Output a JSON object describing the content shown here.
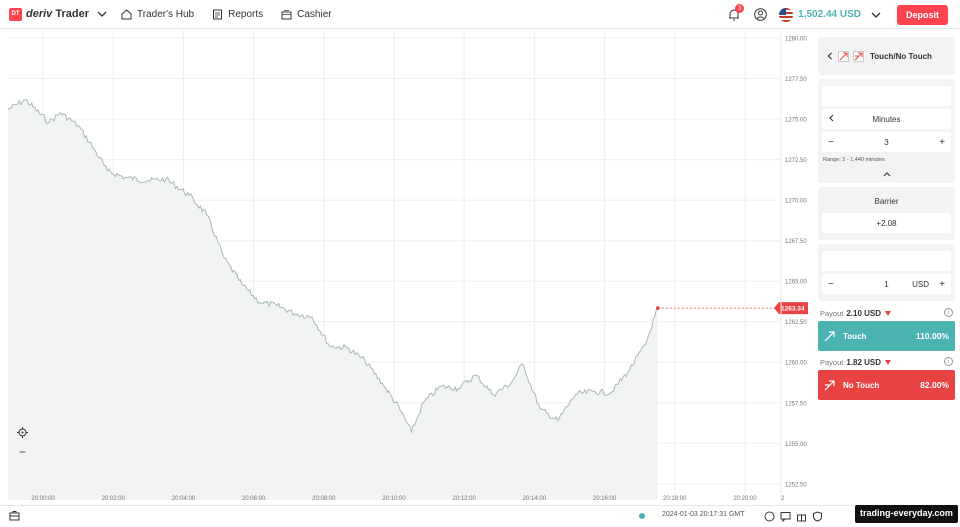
{
  "header": {
    "logo_badge": "DT",
    "logo_brand": "deriv",
    "logo_product": "Trader",
    "nav": [
      {
        "label": "Trader's Hub",
        "icon": "home-icon"
      },
      {
        "label": "Reports",
        "icon": "reports-icon"
      },
      {
        "label": "Cashier",
        "icon": "cashier-icon"
      }
    ],
    "notification_count": "3",
    "balance": "1,502.44 USD",
    "deposit_label": "Deposit"
  },
  "chart": {
    "y_ticks": [
      "1280.00",
      "1277.50",
      "1275.00",
      "1272.50",
      "1270.00",
      "1267.50",
      "1265.00",
      "1262.50",
      "1260.00",
      "1257.50",
      "1255.00",
      "1252.50"
    ],
    "x_ticks": [
      "20:00:00",
      "20:02:00",
      "20:04:00",
      "20:06:00",
      "20:08:00",
      "20:10:00",
      "20:12:00",
      "20:14:00",
      "20:16:00",
      "20:18:00",
      "20:20:00"
    ],
    "current_price": "1263.34",
    "line_color": "#a9b8bc",
    "fill_color": "#f2f4f4",
    "marker_color": "#e84242",
    "zoom_out_label": "−",
    "axis_extra_bottom": "2"
  },
  "chart_data": {
    "type": "line",
    "x_unit": "time",
    "y_range": [
      1251.5,
      1280.5
    ],
    "x_range": [
      "19:59:00",
      "20:21:00"
    ],
    "points": [
      [
        "19:59:00",
        1275.6
      ],
      [
        "19:59:30",
        1276.2
      ],
      [
        "20:00:10",
        1274.8
      ],
      [
        "20:00:30",
        1275.4
      ],
      [
        "20:01:00",
        1274.6
      ],
      [
        "20:01:30",
        1273.0
      ],
      [
        "20:01:50",
        1271.8
      ],
      [
        "20:02:20",
        1271.4
      ],
      [
        "20:03:00",
        1271.2
      ],
      [
        "20:03:30",
        1271.3
      ],
      [
        "20:04:10",
        1270.3
      ],
      [
        "20:04:40",
        1269.1
      ],
      [
        "20:05:10",
        1266.4
      ],
      [
        "20:05:40",
        1264.8
      ],
      [
        "20:06:10",
        1263.7
      ],
      [
        "20:06:40",
        1263.5
      ],
      [
        "20:07:10",
        1263.0
      ],
      [
        "20:07:40",
        1262.8
      ],
      [
        "20:08:10",
        1261.0
      ],
      [
        "20:08:40",
        1260.9
      ],
      [
        "20:09:10",
        1260.1
      ],
      [
        "20:09:40",
        1258.7
      ],
      [
        "20:10:10",
        1257.1
      ],
      [
        "20:10:30",
        1255.7
      ],
      [
        "20:10:50",
        1257.5
      ],
      [
        "20:11:20",
        1258.5
      ],
      [
        "20:11:50",
        1258.4
      ],
      [
        "20:12:20",
        1259.2
      ],
      [
        "20:12:50",
        1258.0
      ],
      [
        "20:13:20",
        1258.7
      ],
      [
        "20:13:40",
        1259.9
      ],
      [
        "20:14:10",
        1257.1
      ],
      [
        "20:14:40",
        1256.4
      ],
      [
        "20:15:10",
        1258.0
      ],
      [
        "20:15:40",
        1258.2
      ],
      [
        "20:16:10",
        1258.1
      ],
      [
        "20:16:40",
        1259.4
      ],
      [
        "20:17:10",
        1261.1
      ],
      [
        "20:17:31",
        1263.34
      ]
    ]
  },
  "sidebar": {
    "trade_type": "Touch/No Touch",
    "duration_unit": "Minutes",
    "duration_value": "3",
    "range_text": "Range: 2 - 1,440 minutes",
    "barrier_label": "Barrier",
    "barrier_value": "+2.08",
    "stake_value": "1",
    "stake_currency": "USD",
    "payout_label": "Payout",
    "touch_payout": "2.10 USD",
    "touch_label": "Touch",
    "touch_pct": "110.00%",
    "notouch_payout": "1.82 USD",
    "notouch_label": "No Touch",
    "notouch_pct": "82.00%"
  },
  "footer": {
    "datetime": "2024-01-03 20:17:31 GMT",
    "watermark": "trading-everyday.com"
  }
}
